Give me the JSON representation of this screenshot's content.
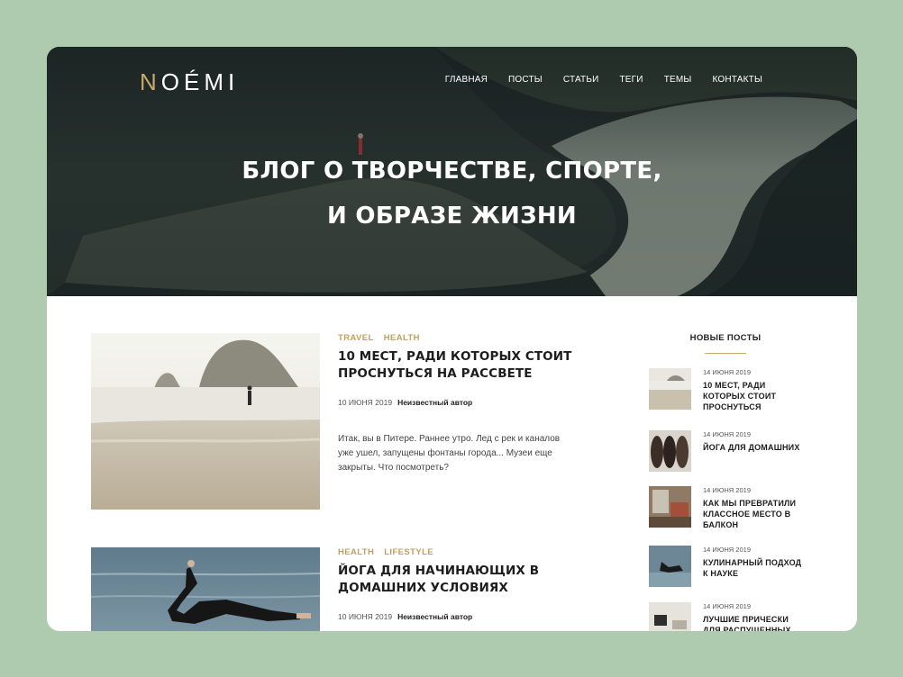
{
  "header": {
    "logo_accent": "N",
    "logo_rest": "OÉMI",
    "nav": [
      "ГЛАВНАЯ",
      "ПОСТЫ",
      "СТАТЬИ",
      "ТЕГИ",
      "ТЕМЫ",
      "КОНТАКТЫ"
    ]
  },
  "hero": {
    "title_line1": "БЛОГ О ТВОРЧЕСТВЕ, СПОРТЕ,",
    "title_line2": "И ОБРАЗЕ ЖИЗНИ"
  },
  "posts": [
    {
      "tags": [
        "TRAVEL",
        "HEALTH"
      ],
      "title": "10 МЕСТ, РАДИ КОТОРЫХ СТОИТ ПРОСНУТЬСЯ НА РАССВЕТЕ",
      "date": "10 ИЮНЯ 2019",
      "author": "Неизвестный автор",
      "excerpt": "Итак, вы в Питере. Раннее утро. Лед с рек и каналов уже ушел, запущены фонтаны города... Музеи еще закрыты. Что посмотреть?"
    },
    {
      "tags": [
        "HEALTH",
        "LIFESTYLE"
      ],
      "title": "ЙОГА ДЛЯ НАЧИНАЮЩИХ В ДОМАШНИХ УСЛОВИЯХ",
      "date": "10 ИЮНЯ 2019",
      "author": "Неизвестный автор",
      "excerpt": ""
    }
  ],
  "sidebar": {
    "title": "НОВЫЕ ПОСТЫ",
    "items": [
      {
        "date": "14 ИЮНЯ 2019",
        "title": "10 МЕСТ, РАДИ КОТОРЫХ СТОИТ ПРОСНУТЬСЯ"
      },
      {
        "date": "14 ИЮНЯ 2019",
        "title": "ЙОГА ДЛЯ ДОМАШНИХ"
      },
      {
        "date": "14 ИЮНЯ 2019",
        "title": "КАК МЫ ПРЕВРАТИЛИ КЛАССНОЕ МЕСТО В БАЛКОН"
      },
      {
        "date": "14 ИЮНЯ 2019",
        "title": "КУЛИНАРНЫЙ ПОДХОД К НАУКЕ"
      },
      {
        "date": "14 ИЮНЯ 2019",
        "title": "ЛУЧШИЕ ПРИЧЕСКИ ДЛЯ РАСПУЩЕННЫХ"
      }
    ]
  },
  "colors": {
    "accent": "#c8a96a",
    "page_background": "#aecaaf"
  }
}
